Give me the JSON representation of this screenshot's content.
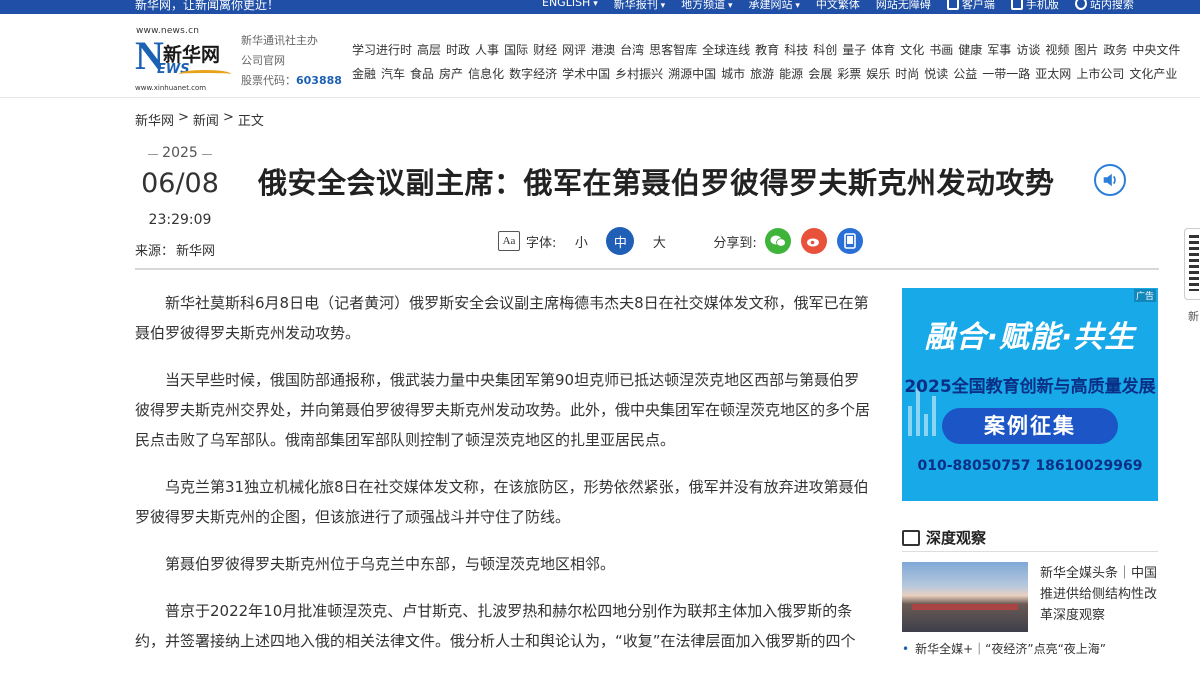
{
  "topbar": {
    "slogan": "新华网，让新闻离你更近！",
    "nav": [
      {
        "label": "ENGLISH",
        "dropdown": true
      },
      {
        "label": "新华报刊",
        "dropdown": true
      },
      {
        "label": "地方频道",
        "dropdown": true
      },
      {
        "label": "承建网站",
        "dropdown": true
      },
      {
        "label": "中文繁体",
        "dropdown": false
      },
      {
        "label": "网站无障碍",
        "dropdown": false
      }
    ],
    "client_label": "客户端",
    "mobile_label": "手机版",
    "search_label": "站内搜索"
  },
  "header": {
    "logo_url_text": "www.news.cn",
    "logo_cn": "新华网",
    "logo_en_n": "N",
    "logo_en_rest": "EWS",
    "logo_url_bottom": "www.xinhuanet.com",
    "org_line1": "新华通讯社主办",
    "org_line2": "公司官网",
    "stock_label": "股票代码：",
    "stock_code": "603888",
    "channels_row1": [
      "学习进行时",
      "高层",
      "时政",
      "人事",
      "国际",
      "财经",
      "网评",
      "港澳",
      "台湾",
      "思客智库",
      "全球连线",
      "教育",
      "科技",
      "科创",
      "量子",
      "体育",
      "文化",
      "书画",
      "健康",
      "军事",
      "访谈",
      "视频",
      "图片",
      "政务",
      "中央文件"
    ],
    "channels_row2": [
      "金融",
      "汽车",
      "食品",
      "房产",
      "信息化",
      "数字经济",
      "学术中国",
      "乡村振兴",
      "溯源中国",
      "城市",
      "旅游",
      "能源",
      "会展",
      "彩票",
      "娱乐",
      "时尚",
      "悦读",
      "公益",
      "一带一路",
      "亚太网",
      "上市公司",
      "文化产业"
    ]
  },
  "breadcrumb": [
    "新华网",
    ">",
    "新闻",
    ">",
    "正文"
  ],
  "article_meta": {
    "year": "2025",
    "day": "06/08",
    "time": "23:29:09",
    "source_label": "来源：",
    "source": "新华网"
  },
  "headline": "俄安全会议副主席：俄军在第聂伯罗彼得罗夫斯克州发动攻势",
  "tools": {
    "font_icon": "Aa",
    "font_label": "字体:",
    "sizes": [
      "小",
      "中",
      "大"
    ],
    "active_size": "中",
    "share_label": "分享到:"
  },
  "icons": {
    "speaker": "speaker-icon",
    "wechat": "wechat-icon",
    "weibo": "weibo-icon",
    "mobile": "mobile-icon"
  },
  "colors": {
    "brand_blue": "#1f4fa6",
    "accent_blue": "#1f5fb6",
    "wechat_green": "#3fb33a",
    "weibo_red": "#e8513a"
  },
  "article": {
    "paragraphs": [
      "新华社莫斯科6月8日电（记者黄河）俄罗斯安全会议副主席梅德韦杰夫8日在社交媒体发文称，俄军已在第聂伯罗彼得罗夫斯克州发动攻势。",
      "当天早些时候，俄国防部通报称，俄武装力量中央集团军第90坦克师已抵达顿涅茨克地区西部与第聂伯罗彼得罗夫斯克州交界处，并向第聂伯罗彼得罗夫斯克州发动攻势。此外，俄中央集团军在顿涅茨克地区的多个居民点击败了乌军部队。俄南部集团军部队则控制了顿涅茨克地区的扎里亚居民点。",
      "乌克兰第31独立机械化旅8日在社交媒体发文称，在该旅防区，形势依然紧张，俄军并没有放弃进攻第聂伯罗彼得罗夫斯克州的企图，但该旅进行了顽强战斗并守住了防线。",
      "第聂伯罗彼得罗夫斯克州位于乌克兰中东部，与顿涅茨克地区相邻。",
      "普京于2022年10月批准顿涅茨克、卢甘斯克、扎波罗热和赫尔松四地分别作为联邦主体加入俄罗斯的条约，并签署接纳上述四地入俄的相关法律文件。俄分析人士和舆论认为，“收复”在法律层面加入俄罗斯的四个"
    ]
  },
  "ad": {
    "tag": "广告",
    "line1": "融合·赋能·共生",
    "line2": "2025全国教育创新与高质量发展",
    "line3": "案例征集",
    "line4": "010-88050757  18610029969"
  },
  "sidebar": {
    "section_title": "深度观察",
    "feature_text": "新华全媒头条｜中国推进供给侧结构性改革深度观察",
    "link_text": "新华全媒+｜“夜经济”点亮“夜上海”"
  },
  "right_edge_label": "新"
}
